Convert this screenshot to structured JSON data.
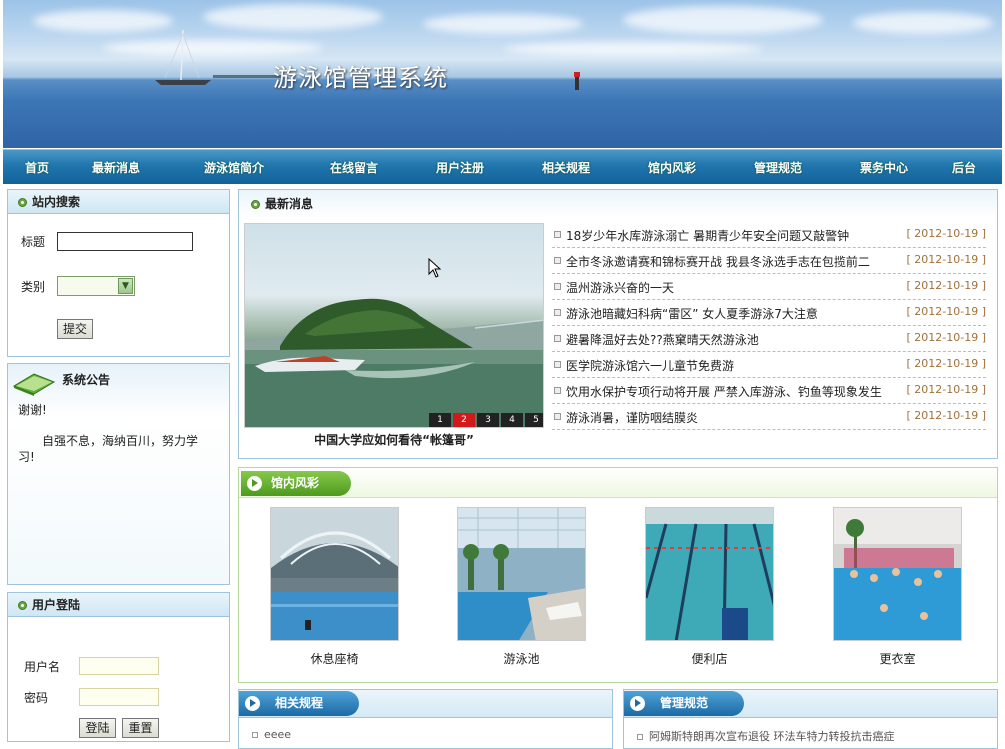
{
  "header": {
    "title": "游泳馆管理系统"
  },
  "nav": [
    "首页",
    "最新消息",
    "游泳馆简介",
    "在线留言",
    "用户注册",
    "相关规程",
    "馆内风彩",
    "管理规范",
    "票务中心",
    "后台"
  ],
  "search": {
    "heading": "站内搜索",
    "title_label": "标题",
    "title_value": "",
    "category_label": "类别",
    "category_value": "",
    "submit_label": "提交"
  },
  "notice": {
    "heading": "系统公告",
    "line1": "谢谢!",
    "line2": "自强不息，海纳百川，努力学习!"
  },
  "login": {
    "heading": "用户登陆",
    "username_label": "用户名",
    "password_label": "密码",
    "login_label": "登陆",
    "reset_label": "重置"
  },
  "news": {
    "heading": "最新消息",
    "slide_caption": "中国大学应如何看待“帐篷哥”",
    "pager": [
      "1",
      "2",
      "3",
      "4",
      "5"
    ],
    "active_page": "2",
    "items": [
      {
        "title": "18岁少年水库游泳溺亡 暑期青少年安全问题又敲警钟",
        "date": "[ 2012-10-19 ]"
      },
      {
        "title": "全市冬泳邀请赛和锦标赛开战 我县冬泳选手志在包揽前二",
        "date": "[ 2012-10-19 ]"
      },
      {
        "title": "温州游泳兴奋的一天",
        "date": "[ 2012-10-19 ]"
      },
      {
        "title": "游泳池暗藏妇科病“雷区” 女人夏季游泳7大注意",
        "date": "[ 2012-10-19 ]"
      },
      {
        "title": "避暑降温好去处??燕窠晴天然游泳池",
        "date": "[ 2012-10-19 ]"
      },
      {
        "title": "医学院游泳馆六一儿童节免费游",
        "date": "[ 2012-10-19 ]"
      },
      {
        "title": "饮用水保护专项行动将开展 严禁入库游泳、钓鱼等现象发生",
        "date": "[ 2012-10-19 ]"
      },
      {
        "title": "游泳消暑，谨防咽结膜炎",
        "date": "[ 2012-10-19 ]"
      }
    ]
  },
  "gallery": {
    "heading": "馆内风彩",
    "photos": [
      "休息座椅",
      "游泳池",
      "便利店",
      "更衣室"
    ]
  },
  "rules": {
    "heading": "相关规程",
    "first_item": "eeee"
  },
  "management": {
    "heading": "管理规范",
    "first_item": "阿姆斯特朗再次宣布退役 环法车特力转投抗击癌症"
  }
}
